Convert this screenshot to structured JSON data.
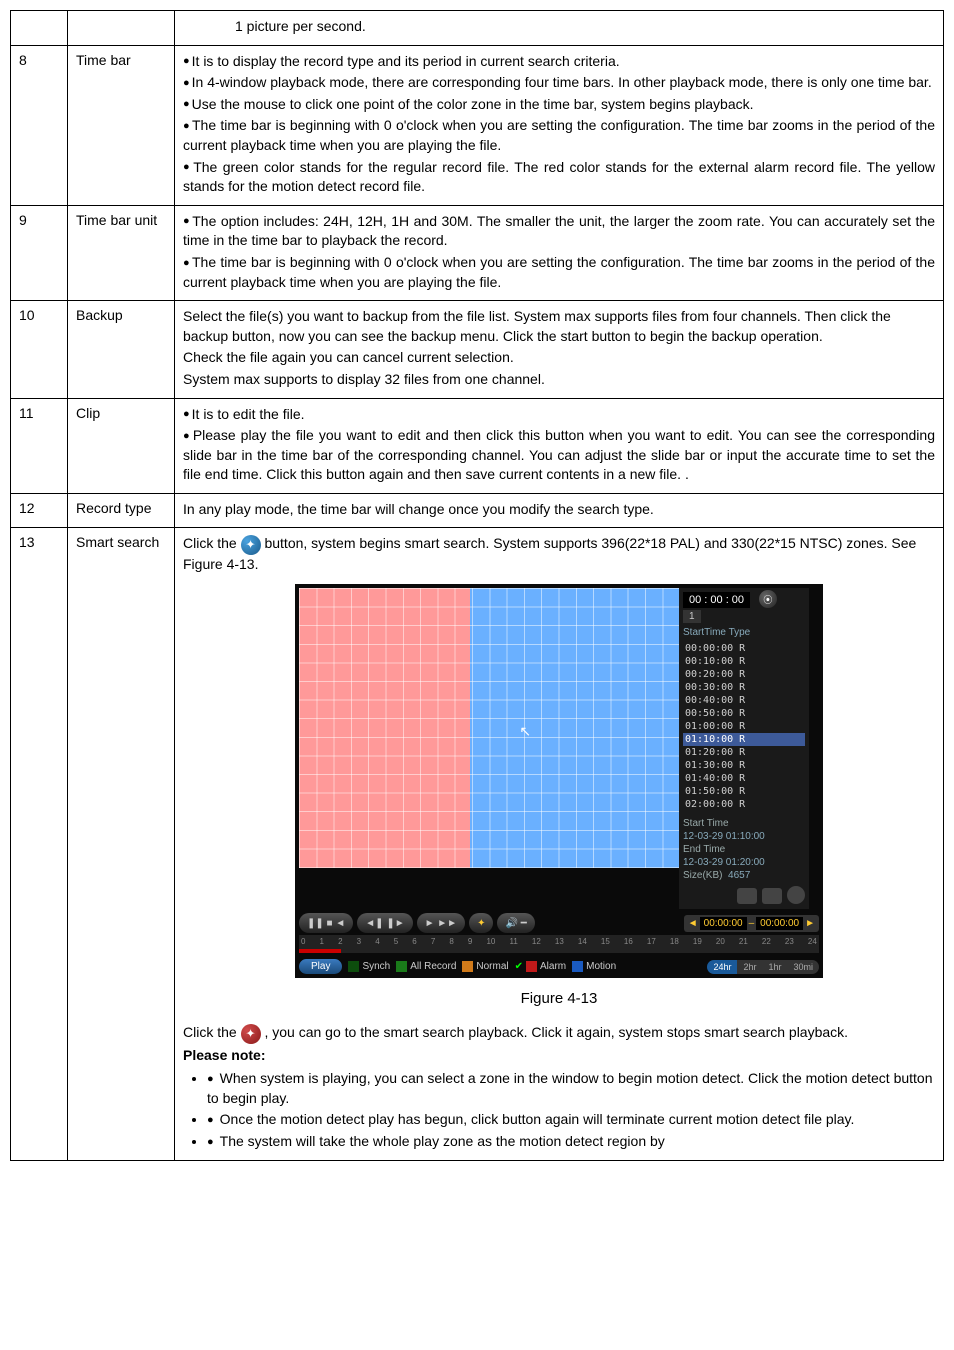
{
  "rows": {
    "r0": {
      "text": "1 picture per second."
    },
    "r8": {
      "num": "8",
      "label": "Time bar",
      "p1": "It is to display the record type and its period in current search criteria.",
      "p2": "In 4-window playback mode, there are corresponding four time bars. In other playback mode, there is only one time bar.",
      "p3": "Use the mouse to click one point of the color zone in the time bar, system begins playback.",
      "p4": "The time bar is beginning with 0 o'clock when you are setting the configuration. The time bar zooms in the period of the current playback time when you are playing the file.",
      "p5": "The green color stands for the regular record file. The red color stands for the external alarm record file. The yellow stands for the motion detect record file."
    },
    "r9": {
      "num": "9",
      "label": "Time bar unit",
      "p1": "The option includes: 24H, 12H, 1H and 30M. The smaller the unit, the larger the zoom rate. You can accurately set the time in the time bar to playback the record.",
      "p2": "The time bar is beginning with 0 o'clock when you are setting the configuration. The time bar zooms in the period of the current playback time when you are playing the file."
    },
    "r10": {
      "num": "10",
      "label": "Backup",
      "p1": "Select the file(s) you want to backup from the file list. System max supports files from four channels. Then click the backup button, now you can see the backup menu. Click the start button to begin the backup operation.",
      "p2": "Check the file again you can cancel current selection.",
      "p3": "System max supports to display 32 files from one channel."
    },
    "r11": {
      "num": "11",
      "label": "Clip",
      "p1": "It is to edit the file.",
      "p2": "Please play the file you want to edit and then click this button when you want to edit. You can see the corresponding slide bar in the time bar of the corresponding channel. You can adjust the slide bar or input the accurate time to set the file end time.  Click this button again and then save current contents in a new file. ."
    },
    "r12": {
      "num": "12",
      "label": "Record type",
      "p1": "In any play mode, the time bar will change once you modify the search type."
    },
    "r13": {
      "num": "13",
      "label": "Smart search",
      "intro_a": "Click the ",
      "intro_b": " button, system begins smart search. System supports 396(22*18 PAL) and 330(22*15 NTSC) zones. See Figure 4-13.",
      "figcaption": "Figure 4-13",
      "click2_a": "Click the",
      "click2_b": ", you can go to the smart search playback. Click it again, system stops smart search playback.",
      "please_note": "Please note:",
      "n1": "When system is playing, you can select a zone in the window to begin motion detect. Click the motion detect button to begin play.",
      "n2": "Once the motion detect play has begun, click button again will terminate current motion detect file play.",
      "n3": "The system will take the whole play zone as the motion detect region by"
    }
  },
  "figure": {
    "clock": "00 : 00 : 00",
    "ch": "1",
    "list_header": "StartTime Type",
    "file_list": [
      "00:00:00  R",
      "00:10:00  R",
      "00:20:00  R",
      "00:30:00  R",
      "00:40:00  R",
      "00:50:00  R",
      "01:00:00  R",
      "01:10:00  R",
      "01:20:00  R",
      "01:30:00  R",
      "01:40:00  R",
      "01:50:00  R",
      "02:00:00  R"
    ],
    "selected_index": 7,
    "start_label": "Start Time",
    "start_val": "12-03-29  01:10:00",
    "end_label": "End Time",
    "end_val": "12-03-29  01:20:00",
    "size_label": "Size(KB)",
    "size_val": "4657",
    "readout_a": "00:00:00",
    "readout_b": "00:00:00",
    "play": "Play",
    "synch": "Synch",
    "allrec": "All Record",
    "normal": "Normal",
    "alarm": "Alarm",
    "motion": "Motion",
    "zoom": [
      "24hr",
      "2hr",
      "1hr",
      "30mi"
    ],
    "ruler": [
      "0",
      "1",
      "2",
      "3",
      "4",
      "5",
      "6",
      "7",
      "8",
      "9",
      "10",
      "11",
      "12",
      "13",
      "14",
      "15",
      "16",
      "17",
      "18",
      "19",
      "20",
      "21",
      "22",
      "23",
      "24"
    ]
  }
}
